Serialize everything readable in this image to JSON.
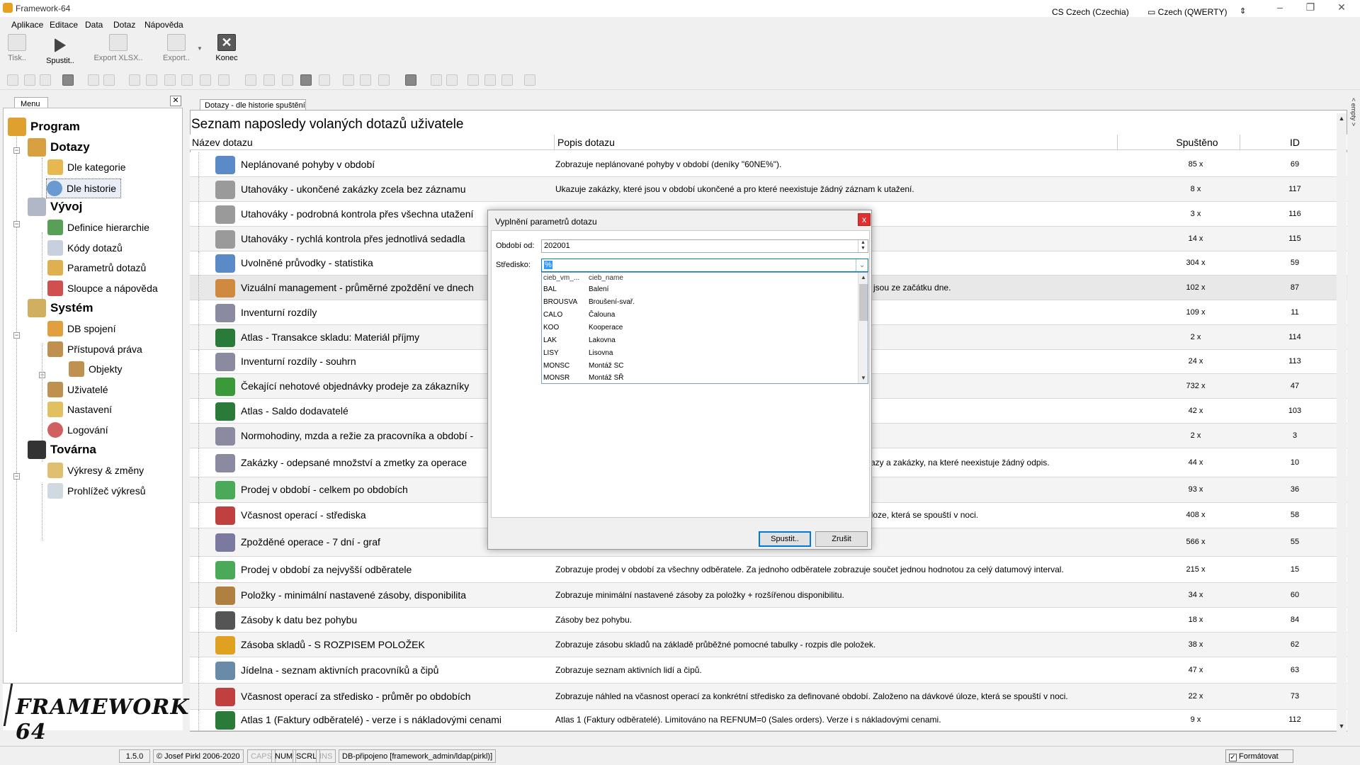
{
  "window": {
    "title": "Framework-64",
    "language": "CS Czech (Czechia)",
    "keyboard": "Czech (QWERTY)"
  },
  "menu": [
    "Aplikace",
    "Editace",
    "Data",
    "Dotaz",
    "Nápověda"
  ],
  "ribbon": {
    "print": "Tisk..",
    "run": "Spustit..",
    "export_xlsx": "Export XLSX..",
    "export": "Export..",
    "close": "Konec"
  },
  "left_panel": {
    "tab": "Menu",
    "close": "✕",
    "tree": {
      "program": "Program",
      "dotazy": "Dotazy",
      "dle_kategorie": "Dle kategorie",
      "dle_historie": "Dle historie",
      "vyvoj": "Vývoj",
      "definice_hierarchie": "Definice hierarchie",
      "kody_dotazu": "Kódy dotazů",
      "parametru_dotazu": "Parametrů dotazů",
      "sloupce": "Sloupce a nápověda",
      "system": "Systém",
      "db_spojeni": "DB spojení",
      "pristupova_prava": "Přístupová práva",
      "objekty": "Objekty",
      "uzivatele": "Uživatelé",
      "nastaveni": "Nastavení",
      "logovani": "Logování",
      "tovarna": "Továrna",
      "vykresy": "Výkresy & změny",
      "prohlizec": "Prohlížeč výkresů"
    },
    "logo": "FRAMEWORK 64"
  },
  "content": {
    "tab": "Dotazy - dle historie spuštění",
    "title": "Seznam naposledy volaných dotazů uživatele",
    "columns": {
      "name": "Název dotazu",
      "desc": "Popis dotazu",
      "runs": "Spuštěno",
      "id": "ID"
    },
    "rows": [
      {
        "name": "Neplánované pohyby v období",
        "desc": "Zobrazuje neplánované pohyby v období (deníky \"60NE%\").",
        "runs": "85 x",
        "id": "69",
        "icon": "table-sum-icon",
        "color": "#5a8ac8"
      },
      {
        "name": "Utahováky - ukončené zakázky zcela bez záznamu",
        "desc": "Ukazuje zakázky, které jsou v období ukončené a pro které neexistuje žádný záznam k utažení.",
        "runs": "8 x",
        "id": "117",
        "icon": "wrench-icon",
        "color": "#9a9a9a"
      },
      {
        "name": "Utahováky - podrobná kontrola přes všechna utažení",
        "desc": "",
        "runs": "3 x",
        "id": "116",
        "icon": "wrench-icon",
        "color": "#9a9a9a"
      },
      {
        "name": "Utahováky - rychlá kontrola přes jednotlivá sedadla",
        "desc": "",
        "runs": "14 x",
        "id": "115",
        "icon": "wrench-icon",
        "color": "#9a9a9a"
      },
      {
        "name": "Uvolněné průvodky - statistika",
        "desc": "",
        "runs": "304 x",
        "id": "59",
        "icon": "table-sum-icon",
        "color": "#5a8ac8"
      },
      {
        "name": "Vizuální management - průměrné zpoždění ve dnech",
        "desc": "a jsou ze začátku dne.",
        "runs": "102 x",
        "id": "87",
        "icon": "bar-chart-icon",
        "color": "#d08a40"
      },
      {
        "name": "Inventurní rozdíly",
        "desc": "",
        "runs": "109 x",
        "id": "11",
        "icon": "gears-icon",
        "color": "#8a8aa0"
      },
      {
        "name": "Atlas - Transakce skladu: Materiál příjmy",
        "desc": "",
        "runs": "2 x",
        "id": "114",
        "icon": "ams-globe-icon",
        "color": "#2a7a3a"
      },
      {
        "name": "Inventurní rozdíly - souhrn",
        "desc": "",
        "runs": "24 x",
        "id": "113",
        "icon": "gears-icon",
        "color": "#8a8aa0"
      },
      {
        "name": "Čekající nehotové objednávky prodeje za zákazníky",
        "desc": "",
        "runs": "732 x",
        "id": "47",
        "icon": "cart-icon",
        "color": "#3a9a3a"
      },
      {
        "name": "Atlas - Saldo dodavatelé",
        "desc": "",
        "runs": "42 x",
        "id": "103",
        "icon": "ams-globe-icon",
        "color": "#2a7a3a"
      },
      {
        "name": "Normohodiny, mzda a režie za pracovníka a období -",
        "desc": "",
        "runs": "2 x",
        "id": "3",
        "icon": "gears-icon",
        "color": "#8a8aa0"
      },
      {
        "name": "Zakázky - odepsané množství a zmetky za operace",
        "desc": "kazy a zakázky, na které neexistuje žádný odpis.",
        "runs": "44 x",
        "id": "10",
        "icon": "gears-icon",
        "color": "#8a8aa0"
      },
      {
        "name": "Prodej v období - celkem po obdobích",
        "desc": "",
        "runs": "93 x",
        "id": "36",
        "icon": "box-chart-icon",
        "color": "#4aaa5a"
      },
      {
        "name": "Včasnost operací - střediska",
        "desc": "úloze, která se spouští v noci.",
        "runs": "408 x",
        "id": "58",
        "icon": "gauge-icon",
        "color": "#c04040"
      },
      {
        "name": "Zpožděné operace - 7 dní - graf",
        "desc": "",
        "runs": "566 x",
        "id": "55",
        "icon": "chart-doc-icon",
        "color": "#7a7aa0"
      },
      {
        "name": "Prodej v období za nejvyšší odběratele",
        "desc": "Zobrazuje prodej v období za všechny odběratele. Za jednoho odběratele zobrazuje součet jednou hodnotou za celý datumový interval.",
        "runs": "215 x",
        "id": "15",
        "icon": "box-chart-icon",
        "color": "#4aaa5a"
      },
      {
        "name": "Položky - minimální nastavené zásoby, disponibilita",
        "desc": "Zobrazuje minimální nastavené zásoby za položky + rozšířenou disponibilitu.",
        "runs": "34 x",
        "id": "60",
        "icon": "package-icon",
        "color": "#b08040"
      },
      {
        "name": "Zásoby k datu bez pohybu",
        "desc": "Zásoby bez pohybu.",
        "runs": "18 x",
        "id": "84",
        "icon": "trash-icon",
        "color": "#555555"
      },
      {
        "name": "Zásoba skladů - S ROZPISEM POLOŽEK",
        "desc": "Zobrazuje zásobu skladů na základě průběžné pomocné tabulky - rozpis dle položek.",
        "runs": "38 x",
        "id": "62",
        "icon": "sigma-icon",
        "color": "#e0a020"
      },
      {
        "name": "Jídelna - seznam aktivních pracovníků a čipů",
        "desc": "Zobrazuje seznam aktivních lidí a čipů.",
        "runs": "47 x",
        "id": "63",
        "icon": "people-icon",
        "color": "#6a8aaa"
      },
      {
        "name": "Včasnost operací za středisko - průměr po obdobích",
        "desc": "Zobrazuje náhled na včasnost operací za konkrétní středisko za definované období. Založeno na dávkové úloze, která se spouští v noci.",
        "runs": "22 x",
        "id": "73",
        "icon": "gauge-icon",
        "color": "#c04040"
      },
      {
        "name": "Atlas 1 (Faktury odběratelé) - verze i s nákladovými cenami",
        "desc": "Atlas 1 (Faktury odběratelé). Limitováno na REFNUM=0 (Sales orders). Verze i s nákladovými cenami.",
        "runs": "9 x",
        "id": "112",
        "icon": "ams-globe-icon",
        "color": "#2a7a3a"
      }
    ]
  },
  "side_grip": "< empty >",
  "dialog": {
    "title": "Vyplnění parametrů dotazu",
    "close": "x",
    "period_label": "Období od:",
    "period_value": "202001",
    "center_label": "Středisko:",
    "center_value": "%",
    "dropdown": {
      "col1": "cieb_vm_...",
      "col2": "cieb_name",
      "items": [
        {
          "code": "BAL",
          "name": "Balení"
        },
        {
          "code": "BROUSVA",
          "name": "Broušení-svař."
        },
        {
          "code": "CALO",
          "name": "Čalouna"
        },
        {
          "code": "KOO",
          "name": "Kooperace"
        },
        {
          "code": "LAK",
          "name": "Lakovna"
        },
        {
          "code": "LISY",
          "name": "Lisovna"
        },
        {
          "code": "MONSC",
          "name": "Montáž SC"
        },
        {
          "code": "MONSR",
          "name": "Montáž SŘ"
        }
      ]
    },
    "run_button": "Spustit..",
    "cancel_button": "Zrušit"
  },
  "status": {
    "version": "1.5.0",
    "copyright": "© Josef Pirkl 2006-2020",
    "caps": "CAPS",
    "num": "NUM",
    "scrl": "SCRL",
    "ins": "INS",
    "db": "DB-připojeno [framework_admin/ldap(pirkl)]",
    "format_checkbox": "✓",
    "format": "Formátovat"
  }
}
